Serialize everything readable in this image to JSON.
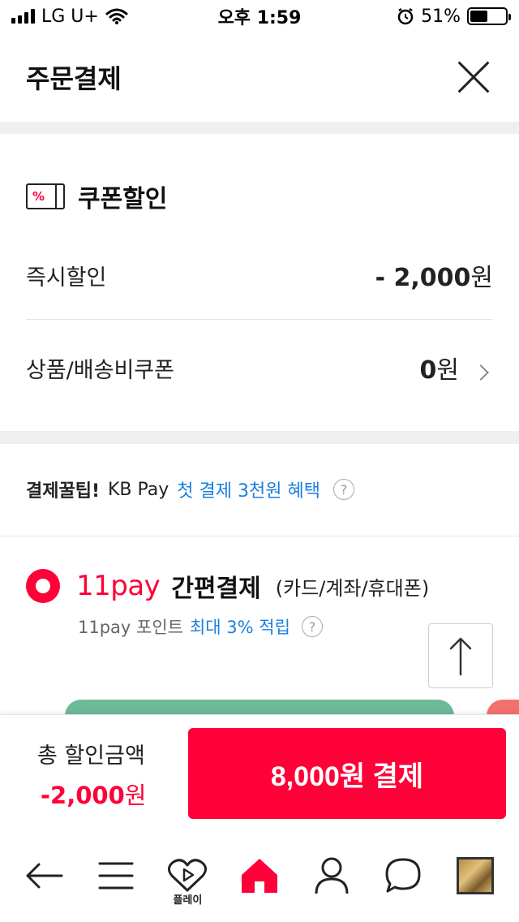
{
  "status_bar": {
    "carrier": "LG U+",
    "time": "오후 1:59",
    "battery_percent": "51%",
    "battery_level": 0.51
  },
  "header": {
    "title": "주문결제"
  },
  "coupon": {
    "title": "쿠폰할인",
    "icon_text": "%",
    "instant_discount_label": "즉시할인",
    "instant_discount_value": "- 2,000",
    "instant_discount_unit": "원",
    "product_coupon_label": "상품/배송비쿠폰",
    "product_coupon_value": "0",
    "product_coupon_unit": "원"
  },
  "tip": {
    "label": "결제꿀팁!",
    "provider": "KB Pay",
    "link_text": "첫 결제 3천원 혜택",
    "help_symbol": "?"
  },
  "pay11": {
    "brand": "11pay",
    "title": "간편결제",
    "subtitle": "(카드/계좌/휴대폰)",
    "point_prefix": "11pay 포인트",
    "point_highlight": "최대 3% 적립",
    "help_symbol": "?"
  },
  "summary": {
    "label": "총 할인금액",
    "amount": "-2,000",
    "amount_unit": "원",
    "pay_button": "8,000원 결제"
  },
  "tab_bar": {
    "play_label": "플레이",
    "icons": [
      "back-arrow-icon",
      "menu-icon",
      "play-heart-icon",
      "home-icon",
      "user-icon",
      "chat-icon",
      "thumbnail-icon"
    ],
    "home_color": "#ff0038"
  },
  "colors": {
    "accent": "#ff0038",
    "link": "#1a7fe0"
  }
}
